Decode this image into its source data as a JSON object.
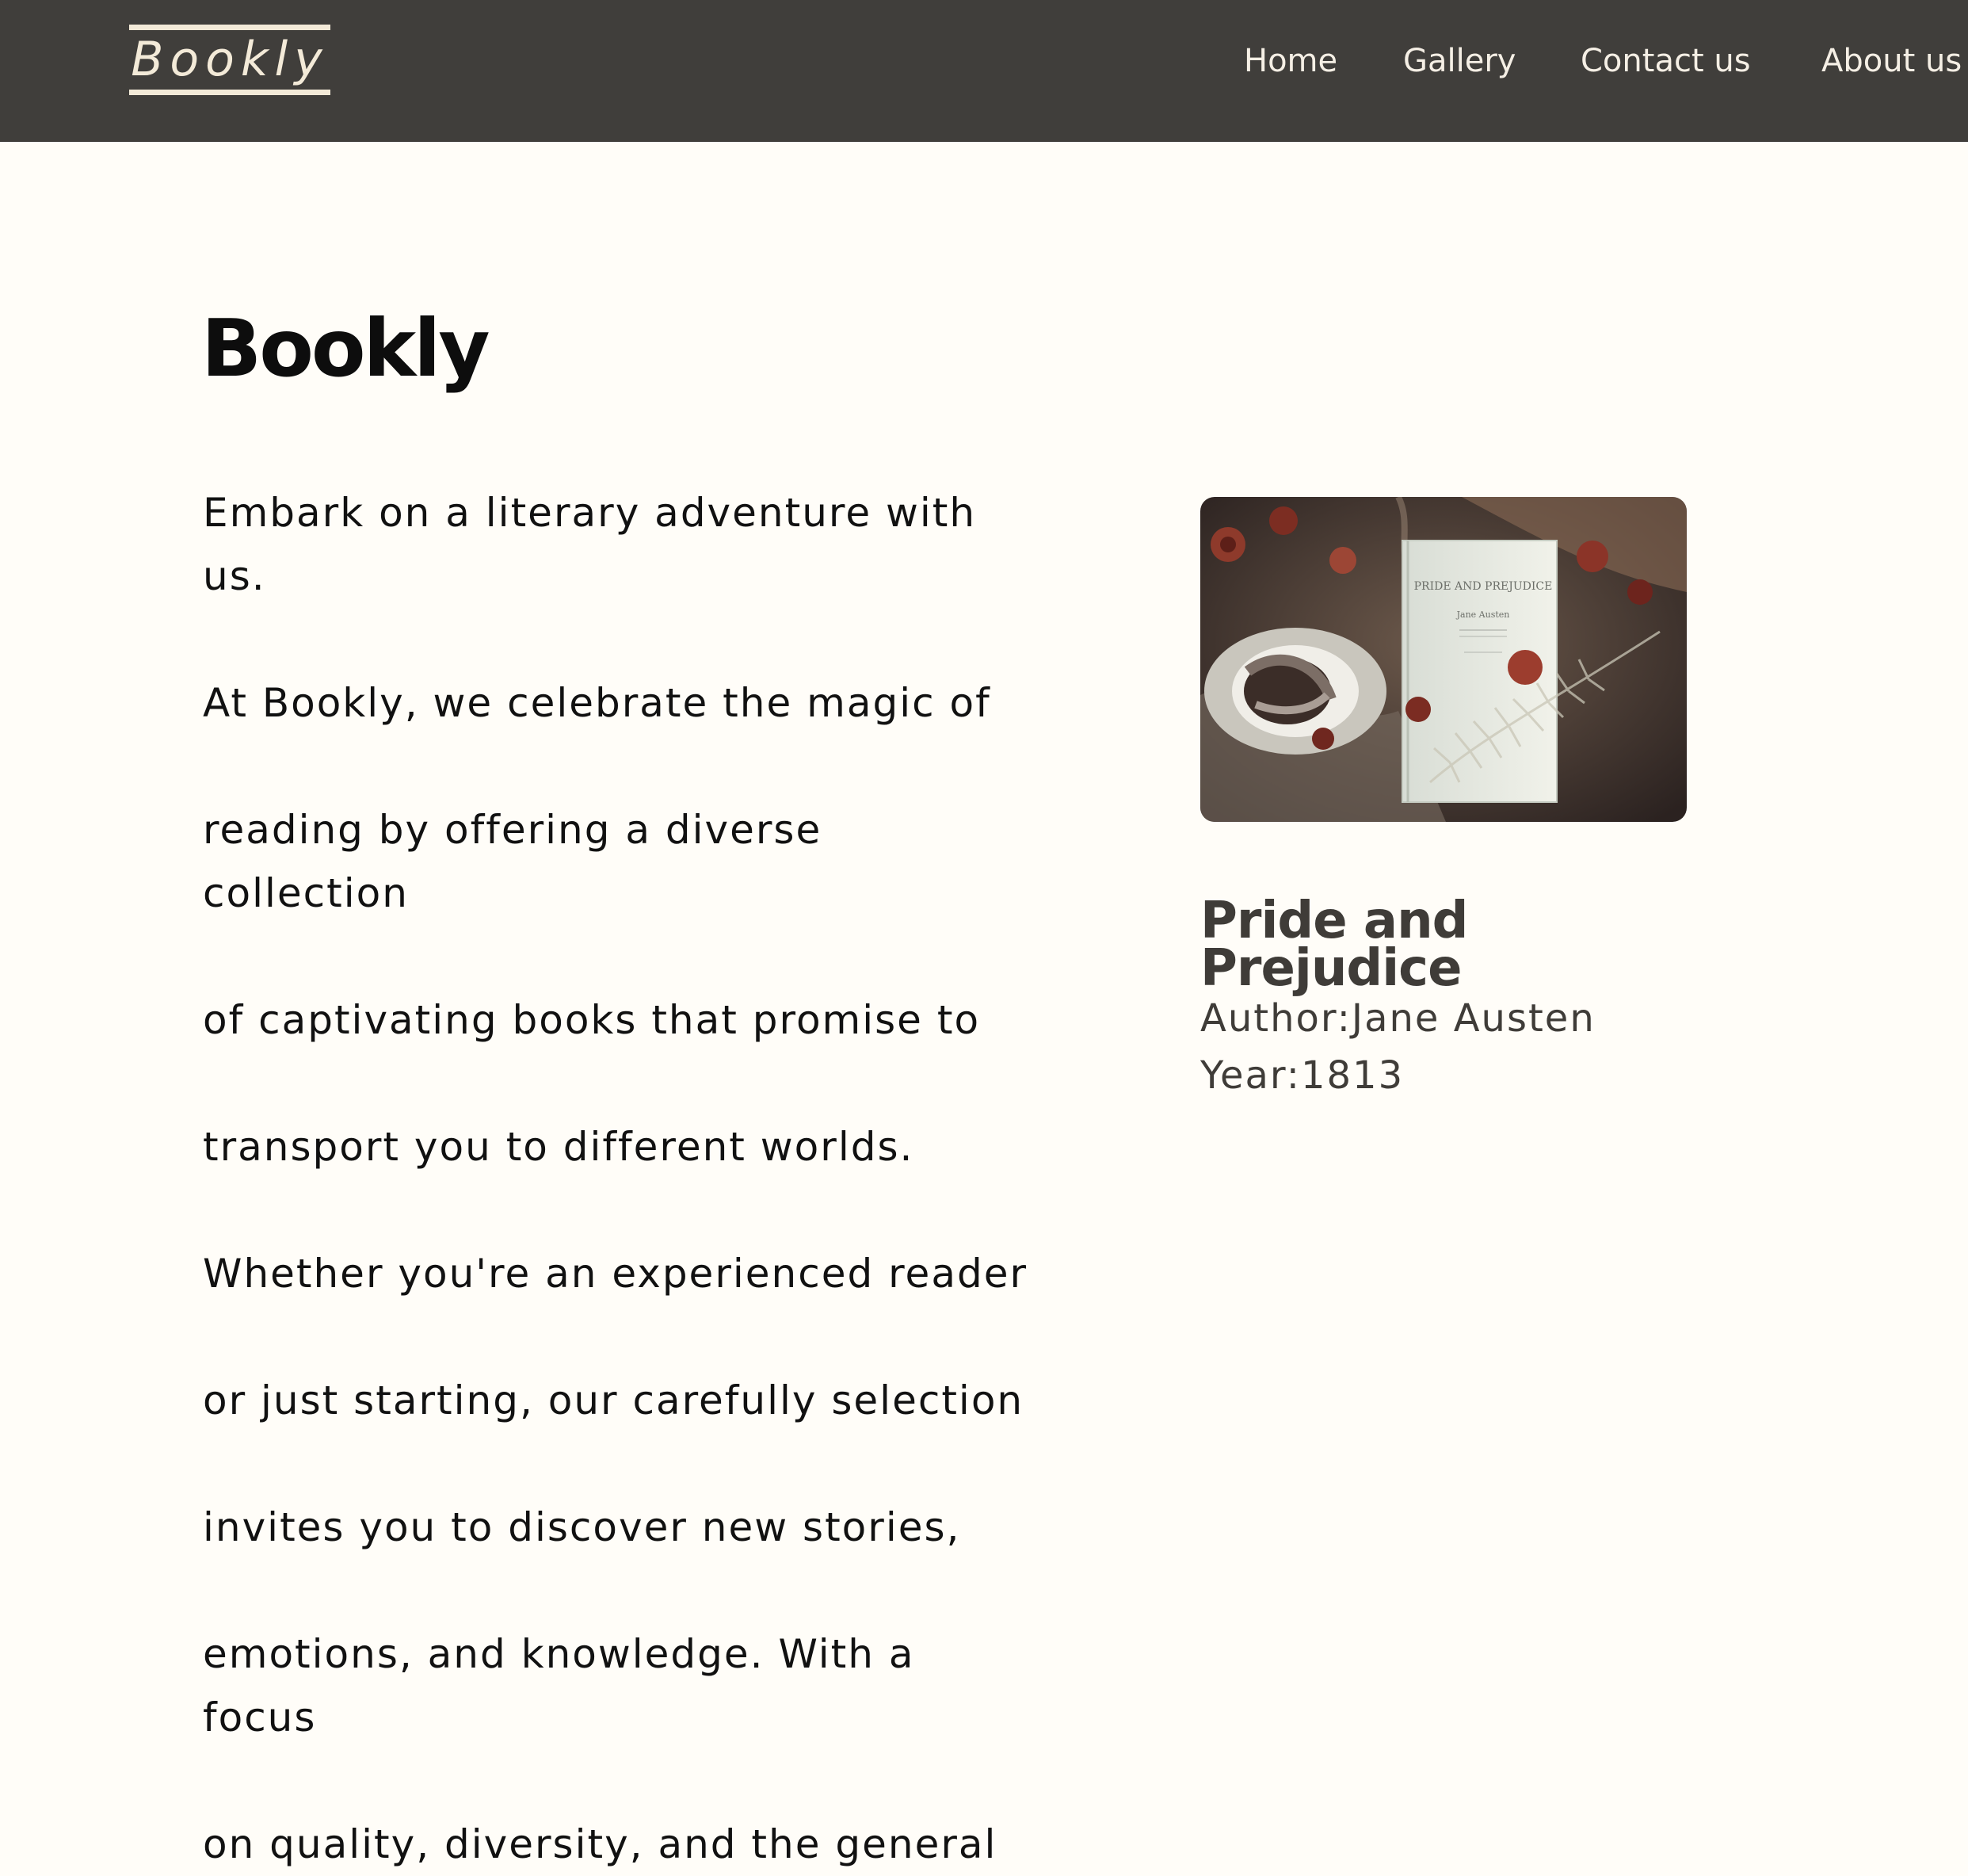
{
  "header": {
    "logo": "Bookly",
    "nav": [
      "Home",
      "Gallery",
      "Contact us",
      "About us"
    ]
  },
  "main": {
    "title": "Bookly",
    "intro_lines": [
      "Embark on a literary adventure with us.",
      "At Bookly, we celebrate the magic of",
      "reading by offering a diverse collection",
      "of captivating books that promise to",
      "transport you to different worlds.",
      "Whether you're an experienced reader",
      "or just starting, our carefully selection",
      "invites you to discover new stories,",
      "emotions, and knowledge. With a focus",
      "on quality, diversity, and the general"
    ]
  },
  "featured_book": {
    "cover_title": "PRIDE AND PREJUDICE",
    "cover_author": "Jane Austen",
    "title": "Pride and\nPrejudice",
    "author": "Author:Jane Austen",
    "year": "Year:1813"
  },
  "colors": {
    "header_bg": "#403e3b",
    "header_text": "#f5efe5",
    "page_bg": "#fffdf8",
    "muted_text": "#3f3c38"
  }
}
